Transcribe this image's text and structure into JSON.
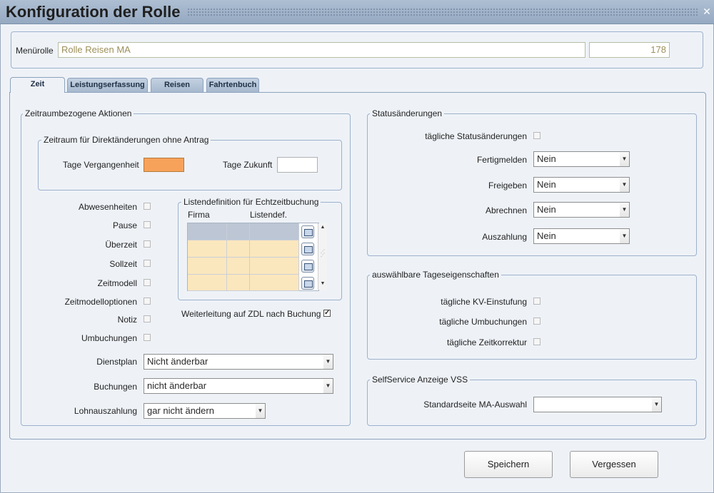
{
  "window": {
    "title": "Konfiguration der Rolle",
    "close_icon": "close-icon"
  },
  "menurolle": {
    "label": "Menürolle",
    "value": "Rolle Reisen MA",
    "id_value": "178"
  },
  "tabs": [
    "Zeit",
    "Leistungserfassung",
    "Reisen",
    "Fahrtenbuch"
  ],
  "active_tab": "Zeit",
  "zeitraum": {
    "legend": "Zeitraumbezogene Aktionen",
    "direkt": {
      "legend": "Zeitraum für Direktänderungen ohne Antrag",
      "vergangenheit_label": "Tage Vergangenheit",
      "zukunft_label": "Tage Zukunft",
      "vergangenheit_color": "#f7a25a"
    },
    "checkboxes": [
      {
        "label": "Abwesenheiten",
        "checked": false
      },
      {
        "label": "Pause",
        "checked": false
      },
      {
        "label": "Überzeit",
        "checked": false
      },
      {
        "label": "Sollzeit",
        "checked": false
      },
      {
        "label": "Zeitmodell",
        "checked": false
      },
      {
        "label": "Zeitmodelloptionen",
        "checked": false
      },
      {
        "label": "Notiz",
        "checked": false
      },
      {
        "label": "Umbuchungen",
        "checked": false
      }
    ],
    "listen": {
      "legend": "Listendefinition für Echtzeitbuchung",
      "col_firma": "Firma",
      "col_listendef": "Listendef."
    },
    "weiterleitung": {
      "label": "Weiterleitung auf ZDL nach Buchung",
      "checked": true
    },
    "dienstplan": {
      "label": "Dienstplan",
      "value": "Nicht änderbar"
    },
    "buchungen": {
      "label": "Buchungen",
      "value": "nicht änderbar"
    },
    "lohnauszahlung": {
      "label": "Lohnauszahlung",
      "value": "gar nicht ändern"
    }
  },
  "status": {
    "legend": "Statusänderungen",
    "taeglich_label": "tägliche Statusänderungen",
    "rows": [
      {
        "label": "Fertigmelden",
        "value": "Nein"
      },
      {
        "label": "Freigeben",
        "value": "Nein"
      },
      {
        "label": "Abrechnen",
        "value": "Nein"
      },
      {
        "label": "Auszahlung",
        "value": "Nein"
      }
    ]
  },
  "tageseigenschaften": {
    "legend": "auswählbare Tageseigenschaften",
    "items": [
      {
        "label": "tägliche KV-Einstufung",
        "checked": false
      },
      {
        "label": "tägliche Umbuchungen",
        "checked": false
      },
      {
        "label": "tägliche Zeitkorrektur",
        "checked": false
      }
    ]
  },
  "selfservice": {
    "legend": "SelfService Anzeige VSS",
    "label": "Standardseite MA-Auswahl",
    "value": ""
  },
  "buttons": {
    "save": "Speichern",
    "cancel": "Vergessen"
  }
}
